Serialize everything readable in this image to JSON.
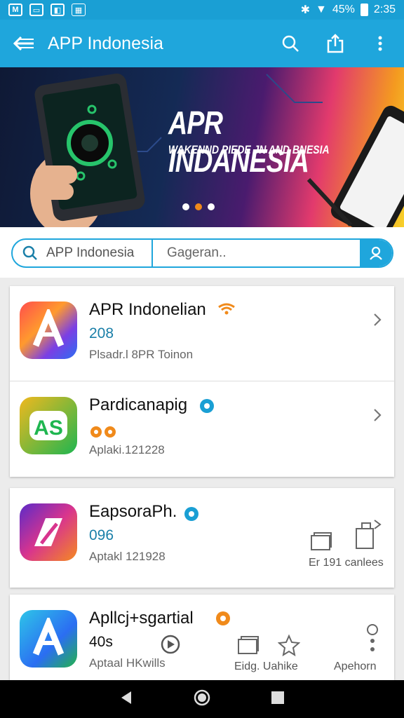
{
  "status_bar": {
    "icons": [
      "notification-m-icon",
      "message-icon",
      "image-icon",
      "grid-icon"
    ],
    "battery": "45%",
    "time": "2:35"
  },
  "app_bar": {
    "title": "APP Indonesia"
  },
  "banner": {
    "title": "APR INDANESIA",
    "subtitle": "WAKENND PIEDE JN AND BNESIA"
  },
  "search": {
    "left_text": "APP Indonesia",
    "right_text": "Gageran.."
  },
  "apps": [
    {
      "name": "APR Indonelian",
      "meta": "208",
      "sub": "Plsadr.l 8PR Toinon"
    },
    {
      "name": "Pardicanapig",
      "meta": "",
      "sub": "Aplaki.121228"
    },
    {
      "name": "EapsoraPh.",
      "meta": "096",
      "sub": "Aptakl 121928",
      "action": "Er 191 canlees"
    },
    {
      "name": "Apllcj+sgartial",
      "meta": "40s",
      "sub": "Aptaal HKwills",
      "action_a": "Eidg. Uahike",
      "action_b": "Apehorn"
    }
  ],
  "colors": {
    "accent": "#1fa6dc",
    "orange": "#f08a1b"
  }
}
